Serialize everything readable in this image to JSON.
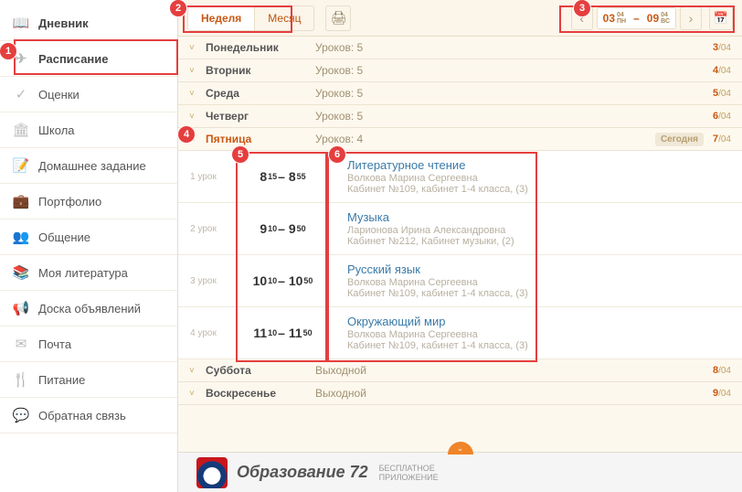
{
  "sidebar": {
    "items": [
      {
        "label": "Дневник",
        "icon": "📖"
      },
      {
        "label": "Расписание",
        "icon": "✈"
      },
      {
        "label": "Оценки",
        "icon": "✓"
      },
      {
        "label": "Школа",
        "icon": "🏛"
      },
      {
        "label": "Домашнее задание",
        "icon": "📝"
      },
      {
        "label": "Портфолио",
        "icon": "💼"
      },
      {
        "label": "Общение",
        "icon": "👥"
      },
      {
        "label": "Моя литература",
        "icon": "📚"
      },
      {
        "label": "Доска объявлений",
        "icon": "📢"
      },
      {
        "label": "Почта",
        "icon": "✉"
      },
      {
        "label": "Питание",
        "icon": "🍴"
      },
      {
        "label": "Обратная связь",
        "icon": "💬"
      }
    ]
  },
  "toolbar": {
    "tabs": {
      "week": "Неделя",
      "month": "Месяц"
    },
    "print_icon": "🖨",
    "date": {
      "start_day": "03",
      "start_sup1": "04",
      "start_sup2": "ПН",
      "end_day": "09",
      "end_sup1": "04",
      "end_sup2": "ВС",
      "sep": "–"
    }
  },
  "days": [
    {
      "name": "Понедельник",
      "sub": "Уроков: 5",
      "count_num": "3",
      "count_den": "04"
    },
    {
      "name": "Вторник",
      "sub": "Уроков: 5",
      "count_num": "4",
      "count_den": "04"
    },
    {
      "name": "Среда",
      "sub": "Уроков: 5",
      "count_num": "5",
      "count_den": "04"
    },
    {
      "name": "Четверг",
      "sub": "Уроков: 5",
      "count_num": "6",
      "count_den": "04"
    },
    {
      "name": "Пятница",
      "sub": "Уроков: 4",
      "count_num": "7",
      "count_den": "04",
      "today": "Сегодня",
      "expanded": true
    },
    {
      "name": "Суббота",
      "sub": "Выходной",
      "count_num": "8",
      "count_den": "04"
    },
    {
      "name": "Воскресенье",
      "sub": "Выходной",
      "count_num": "9",
      "count_den": "04"
    }
  ],
  "friday_lessons": [
    {
      "num": "1 урок",
      "time": {
        "h1": "8",
        "m1": "15",
        "dash": " – ",
        "h2": "8",
        "m2": "55"
      },
      "subject": "Литературное чтение",
      "teacher": "Волкова Марина Сергеевна",
      "room": "Кабинет №109, кабинет 1-4 класса, (3)"
    },
    {
      "num": "2 урок",
      "time": {
        "h1": "9",
        "m1": "10",
        "dash": " – ",
        "h2": "9",
        "m2": "50"
      },
      "subject": "Музыка",
      "teacher": "Ларионова Ирина Александровна",
      "room": "Кабинет №212, Кабинет музыки, (2)"
    },
    {
      "num": "3 урок",
      "time": {
        "h1": "10",
        "m1": "10",
        "dash": " – ",
        "h2": "10",
        "m2": "50"
      },
      "subject": "Русский язык",
      "teacher": "Волкова Марина Сергеевна",
      "room": "Кабинет №109, кабинет 1-4 класса, (3)"
    },
    {
      "num": "4 урок",
      "time": {
        "h1": "11",
        "m1": "10",
        "dash": " – ",
        "h2": "11",
        "m2": "50"
      },
      "subject": "Окружающий мир",
      "teacher": "Волкова Марина Сергеевна",
      "room": "Кабинет №109, кабинет 1-4 класса, (3)"
    }
  ],
  "banner": {
    "title": "Образование 72",
    "line1": "БЕСПЛАТНОЕ",
    "line2": "ПРИЛОЖЕНИЕ"
  },
  "markers": {
    "m1": "1",
    "m2": "2",
    "m3": "3",
    "m4": "4",
    "m5": "5",
    "m6": "6"
  }
}
